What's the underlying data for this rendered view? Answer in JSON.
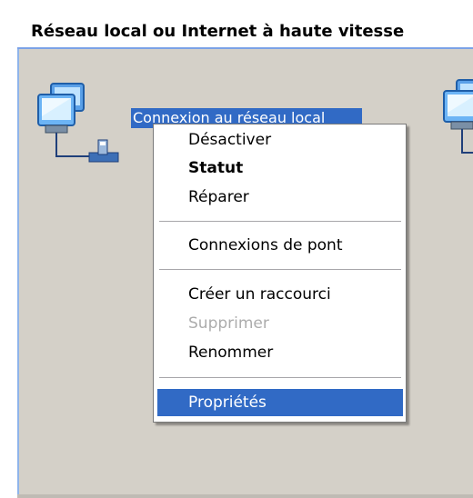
{
  "header": {
    "title": "Réseau local ou Internet à haute vitesse"
  },
  "connection": {
    "label": "Connexion au réseau local",
    "icon": "network-connection-icon"
  },
  "context_menu": {
    "items": [
      {
        "label": "Désactiver",
        "state": "normal"
      },
      {
        "label": "Statut",
        "state": "default"
      },
      {
        "label": "Réparer",
        "state": "normal"
      },
      {
        "label": "Connexions de pont",
        "state": "normal"
      },
      {
        "label": "Créer un raccourci",
        "state": "normal"
      },
      {
        "label": "Supprimer",
        "state": "disabled"
      },
      {
        "label": "Renommer",
        "state": "normal"
      },
      {
        "label": "Propriétés",
        "state": "selected"
      }
    ]
  },
  "colors": {
    "selection": "#316ac5",
    "pane_background": "#d4d0c8",
    "header_rule": "#7ba2e7",
    "disabled_text": "#acacac"
  }
}
